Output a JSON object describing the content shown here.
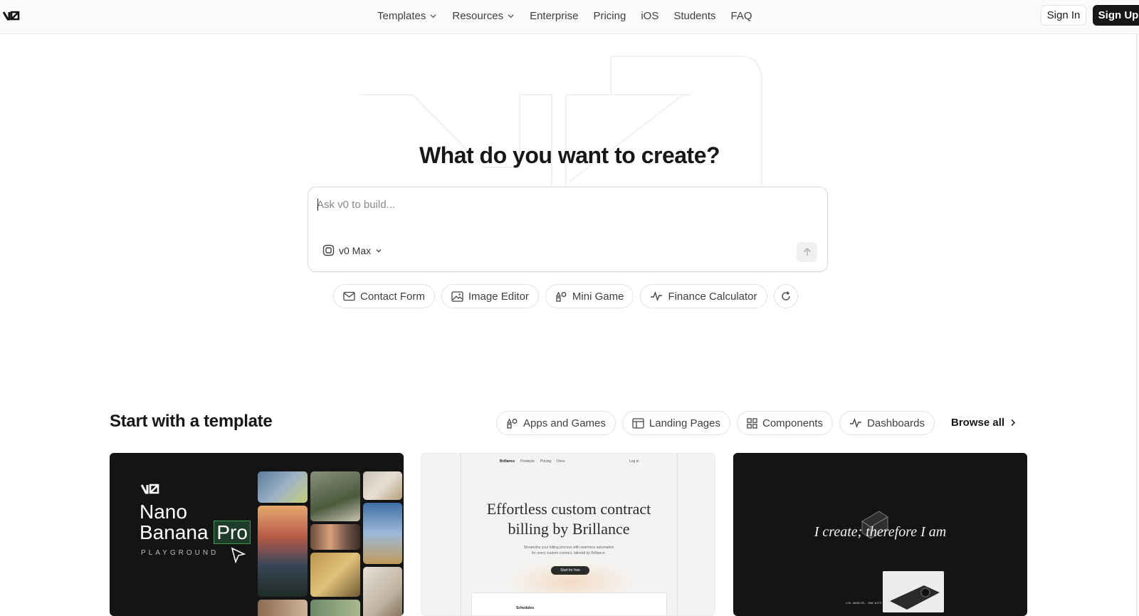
{
  "header": {
    "logo_text": "v0",
    "nav": [
      {
        "label": "Templates",
        "has_dropdown": true
      },
      {
        "label": "Resources",
        "has_dropdown": true
      },
      {
        "label": "Enterprise",
        "has_dropdown": false
      },
      {
        "label": "Pricing",
        "has_dropdown": false
      },
      {
        "label": "iOS",
        "has_dropdown": false
      },
      {
        "label": "Students",
        "has_dropdown": false
      },
      {
        "label": "FAQ",
        "has_dropdown": false
      }
    ],
    "sign_in": "Sign In",
    "sign_up": "Sign Up"
  },
  "hero": {
    "title": "What do you want to create?",
    "input_placeholder": "Ask v0 to build...",
    "input_value": "",
    "model_label": "v0 Max",
    "suggestions": [
      {
        "label": "Contact Form",
        "icon": "mail-icon"
      },
      {
        "label": "Image Editor",
        "icon": "image-icon"
      },
      {
        "label": "Mini Game",
        "icon": "shapes-icon"
      },
      {
        "label": "Finance Calculator",
        "icon": "activity-icon"
      }
    ]
  },
  "templates": {
    "title": "Start with a template",
    "filters": [
      {
        "label": "Apps and Games",
        "icon": "shapes-icon"
      },
      {
        "label": "Landing Pages",
        "icon": "layout-icon"
      },
      {
        "label": "Components",
        "icon": "grid-icon"
      },
      {
        "label": "Dashboards",
        "icon": "activity-icon"
      }
    ],
    "browse_all": "Browse all",
    "cards": [
      {
        "logo": "v0",
        "title_line1": "Nano",
        "title_line2": "Banana",
        "title_badge": "Pro",
        "subtitle": "PLAYGROUND"
      },
      {
        "brand": "Brillance",
        "nav": [
          "Products",
          "Pricing",
          "Docs"
        ],
        "login": "Log in",
        "title_line1": "Effortless custom contract",
        "title_line2": "billing by Brillance",
        "body_line1": "Streamline your billing process with seamless automation",
        "body_line2": "for every custom contract, tailored by Brillance.",
        "cta": "Start for free",
        "panel_title": "Schedules"
      },
      {
        "text": "I create; therefore I am",
        "caption": "LOS ANGELES, NOW WITH OR WITHOUT"
      }
    ]
  },
  "colors": {
    "accent_dark": "#171717",
    "pro_badge": "#3a9d53"
  }
}
